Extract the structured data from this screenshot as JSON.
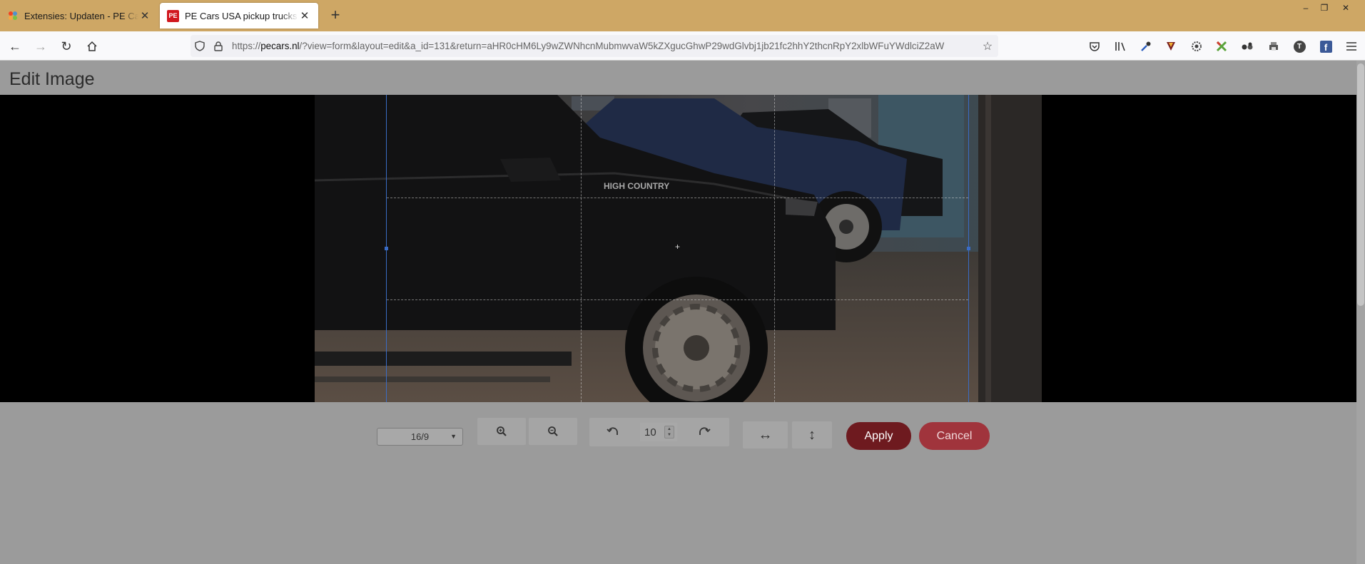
{
  "browser": {
    "tabs": [
      {
        "title": "Extensies: Updaten - PE Cars - B",
        "active": false
      },
      {
        "title": "PE Cars USA pickup trucks Nieuw",
        "active": true
      }
    ],
    "new_tab": "+",
    "url_host": "pecars.nl",
    "url_prefix": "https://",
    "url_rest": "/?view=form&layout=edit&a_id=131&return=aHR0cHM6Ly9wZWNhcnMubmwvaW5kZXgucGhwP29wdGlvbj1jb21fc2hhY2thcnRpY2xlbWFuYWdlciZ2aW",
    "window_controls": [
      "–",
      "❐",
      "✕"
    ],
    "toolbar_icons": [
      "pocket-icon",
      "library-icon",
      "eyedropper-icon",
      "vivaldi-icon",
      "gear-icon",
      "puzzle-icon",
      "glasses-icon",
      "printer-icon",
      "account-icon",
      "facebook-icon",
      "menu-icon"
    ],
    "account_initial": "T",
    "facebook_initial": "f"
  },
  "page": {
    "title": "Edit Image"
  },
  "photo": {
    "badge_text": "HIGH COUNTRY"
  },
  "toolbar": {
    "aspect_ratio": "16/9",
    "zoom_in": "zoom-in-icon",
    "zoom_out": "zoom-out-icon",
    "rotate_left": "rotate-left-icon",
    "rotate_value": "10",
    "rotate_right": "rotate-right-icon",
    "flip_horizontal": "flip-horizontal-icon",
    "flip_vertical": "flip-vertical-icon",
    "apply_label": "Apply",
    "cancel_label": "Cancel"
  },
  "colors": {
    "apply": "#6e1a1f",
    "cancel": "#a0343c",
    "crop_border": "#3a6cc6",
    "tabstrip": "#cea765"
  }
}
